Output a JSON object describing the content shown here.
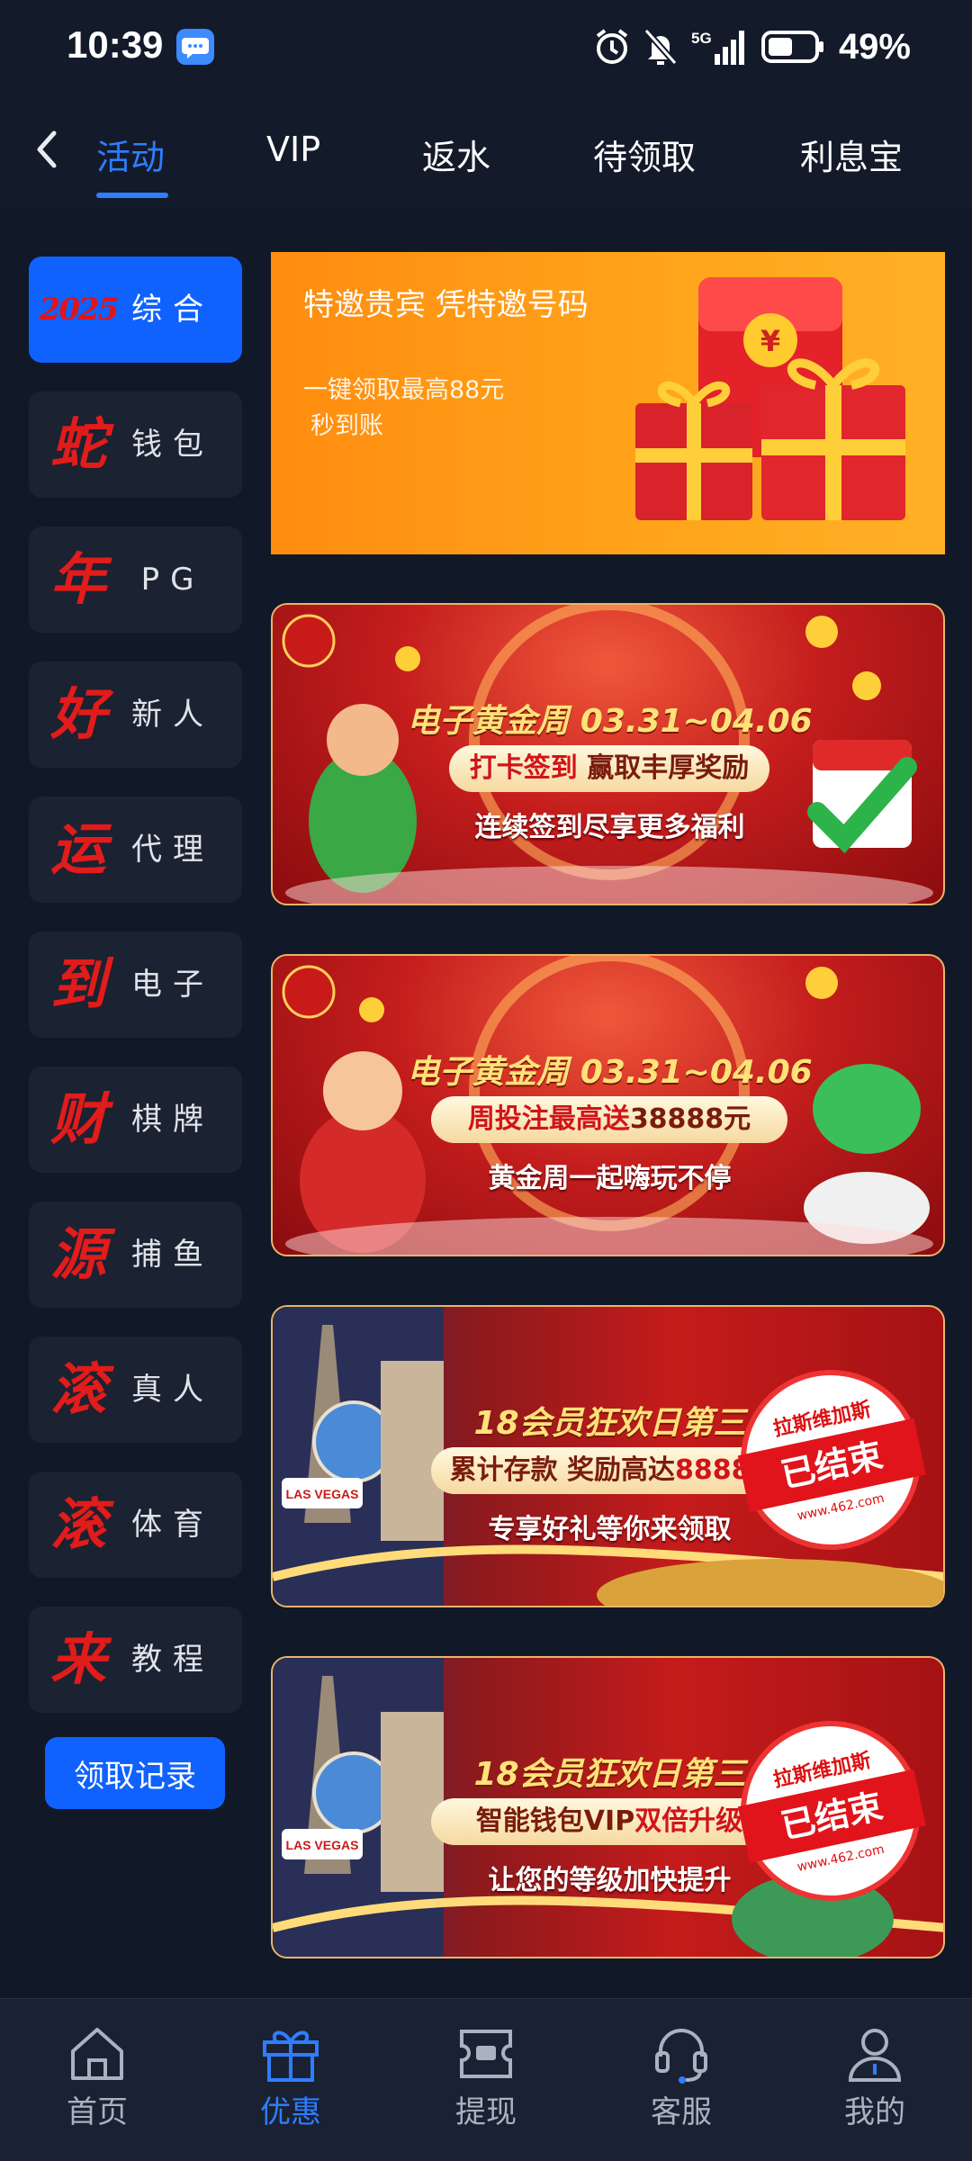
{
  "status_bar": {
    "time": "10:39",
    "network": "5G",
    "battery": "49%"
  },
  "top_tabs": [
    {
      "label": "活动",
      "active": true
    },
    {
      "label": "VIP",
      "active": false
    },
    {
      "label": "返水",
      "active": false
    },
    {
      "label": "待领取",
      "active": false
    },
    {
      "label": "利息宝",
      "active": false
    }
  ],
  "sidebar": {
    "items": [
      {
        "glyph": "2025",
        "label": "综合",
        "active": true
      },
      {
        "glyph": "蛇",
        "label": "钱包",
        "active": false
      },
      {
        "glyph": "年",
        "label": "PG",
        "active": false
      },
      {
        "glyph": "好",
        "label": "新人",
        "active": false
      },
      {
        "glyph": "运",
        "label": "代理",
        "active": false
      },
      {
        "glyph": "到",
        "label": "电子",
        "active": false
      },
      {
        "glyph": "财",
        "label": "棋牌",
        "active": false
      },
      {
        "glyph": "源",
        "label": "捕鱼",
        "active": false
      },
      {
        "glyph": "滚",
        "label": "真人",
        "active": false
      },
      {
        "glyph": "滚",
        "label": "体育",
        "active": false
      },
      {
        "glyph": "来",
        "label": "教程",
        "active": false
      }
    ],
    "record_button": "领取记录"
  },
  "banners": {
    "promo": {
      "title": "特邀贵宾 凭特邀号码",
      "subtitle_line1": "一键领取最高88元",
      "subtitle_line2": "秒到账"
    },
    "gold_week_1": {
      "title": "电子黄金周 03.31~04.06",
      "pill_left": "打卡签到",
      "pill_right": "赢取丰厚奖励",
      "subtitle": "连续签到尽享更多福利"
    },
    "gold_week_2": {
      "title": "电子黄金周 03.31~04.06",
      "pill_left": "周投注最高送",
      "pill_right": "38888元",
      "subtitle": "黄金周一起嗨玩不停"
    },
    "vegas_1": {
      "title": "18会员狂欢日第三",
      "pill_left": "累计存款 奖励高达",
      "pill_right": "88888",
      "subtitle": "专享好礼等你来领取",
      "city_sign": "LAS VEGAS",
      "stamp_top": "拉斯维加斯",
      "stamp_main": "已结束",
      "stamp_url": "www.462.com"
    },
    "vegas_2": {
      "title": "18会员狂欢日第三",
      "pill_left": "智能钱包VIP",
      "pill_right": "双倍升级",
      "subtitle": "让您的等级加快提升",
      "city_sign": "LAS VEGAS",
      "stamp_top": "拉斯维加斯",
      "stamp_main": "已结束",
      "stamp_url": "www.462.com"
    }
  },
  "bottom_nav": [
    {
      "label": "首页",
      "icon": "home-icon",
      "active": false
    },
    {
      "label": "优惠",
      "icon": "gift-icon",
      "active": true
    },
    {
      "label": "提现",
      "icon": "withdraw-icon",
      "active": false
    },
    {
      "label": "客服",
      "icon": "headset-icon",
      "active": false
    },
    {
      "label": "我的",
      "icon": "user-icon",
      "active": false
    }
  ],
  "colors": {
    "background": "#131a29",
    "accent": "#2f7dff",
    "sidebar_active": "#0f62fe",
    "sidebar_item": "#1b2231",
    "glyph_red": "#e21b1b"
  }
}
